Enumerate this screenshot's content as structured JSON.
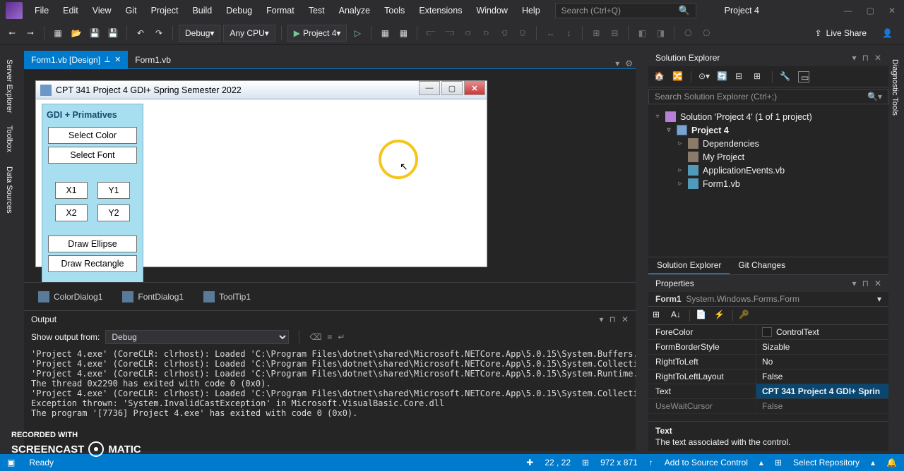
{
  "menu": [
    "File",
    "Edit",
    "View",
    "Git",
    "Project",
    "Build",
    "Debug",
    "Format",
    "Test",
    "Analyze",
    "Tools",
    "Extensions",
    "Window",
    "Help"
  ],
  "search_placeholder": "Search (Ctrl+Q)",
  "project_name": "Project 4",
  "toolbar": {
    "config": "Debug",
    "platform": "Any CPU",
    "start_label": "Project 4",
    "live_share": "Live Share"
  },
  "vtabs": {
    "server": "Server Explorer",
    "toolbox": "Toolbox",
    "datasrc": "Data Sources",
    "diag": "Diagnostic Tools"
  },
  "tabs": [
    {
      "label": "Form1.vb [Design]",
      "active": true
    },
    {
      "label": "Form1.vb",
      "active": false
    }
  ],
  "designer": {
    "form_title": "CPT 341 Project 4 GDI+ Spring Semester 2022",
    "groupbox": {
      "legend": "GDI + Primatives",
      "select_color": "Select Color",
      "select_font": "Select Font",
      "x1": "X1",
      "y1": "Y1",
      "x2": "X2",
      "y2": "Y2",
      "draw_ellipse": "Draw Ellipse",
      "draw_rectangle": "Draw Rectangle"
    }
  },
  "components": {
    "color": "ColorDialog1",
    "font": "FontDialog1",
    "tooltip": "ToolTip1"
  },
  "output": {
    "title": "Output",
    "show_from": "Show output from:",
    "source": "Debug",
    "lines": "'Project 4.exe' (CoreCLR: clrhost): Loaded 'C:\\Program Files\\dotnet\\shared\\Microsoft.NETCore.App\\5.0.15\\System.Buffers.dll'.\n'Project 4.exe' (CoreCLR: clrhost): Loaded 'C:\\Program Files\\dotnet\\shared\\Microsoft.NETCore.App\\5.0.15\\System.Collections.No\n'Project 4.exe' (CoreCLR: clrhost): Loaded 'C:\\Program Files\\dotnet\\shared\\Microsoft.NETCore.App\\5.0.15\\System.Runtime.Compi\nThe thread 0x2290 has exited with code 0 (0x0).\n'Project 4.exe' (CoreCLR: clrhost): Loaded 'C:\\Program Files\\dotnet\\shared\\Microsoft.NETCore.App\\5.0.15\\System.Collections.Co\nException thrown: 'System.InvalidCastException' in Microsoft.VisualBasic.Core.dll\nThe program '[7736] Project 4.exe' has exited with code 0 (0x0)."
  },
  "solution_explorer": {
    "title": "Solution Explorer",
    "search_placeholder": "Search Solution Explorer (Ctrl+;)",
    "root": "Solution 'Project 4' (1 of 1 project)",
    "project": "Project 4",
    "items": {
      "deps": "Dependencies",
      "myproj": "My Project",
      "appev": "ApplicationEvents.vb",
      "form1": "Form1.vb"
    },
    "tabs": {
      "sln": "Solution Explorer",
      "git": "Git Changes"
    }
  },
  "properties": {
    "title": "Properties",
    "object_name": "Form1",
    "object_type": "System.Windows.Forms.Form",
    "rows": [
      {
        "name": "ForeColor",
        "value": "ControlText",
        "swatch": true
      },
      {
        "name": "FormBorderStyle",
        "value": "Sizable"
      },
      {
        "name": "RightToLeft",
        "value": "No"
      },
      {
        "name": "RightToLeftLayout",
        "value": "False"
      },
      {
        "name": "Text",
        "value": "CPT 341 Project 4 GDI+ Sprin",
        "selected": true
      },
      {
        "name": "UseWaitCursor",
        "value": "False"
      }
    ],
    "desc": {
      "title": "Text",
      "body": "The text associated with the control."
    }
  },
  "status": {
    "ready": "Ready",
    "pos": "22 , 22",
    "size": "972 x 871",
    "add_src": "Add to Source Control",
    "sel_repo": "Select Repository"
  },
  "watermark": {
    "label": "RECORDED WITH",
    "brand_a": "SCREENCAST",
    "brand_b": "MATIC"
  }
}
